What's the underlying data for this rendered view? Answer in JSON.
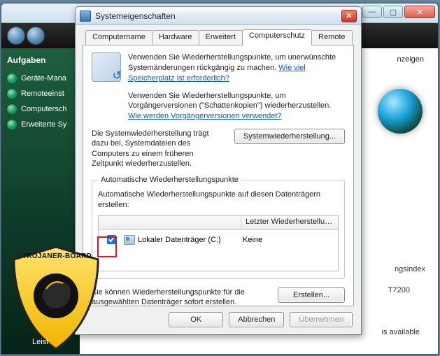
{
  "bg": {
    "tasks_header": "Aufgaben",
    "sidebar": [
      "Geräte-Mana",
      "Remoteeinst",
      "Computersch",
      "Erweiterte Sy"
    ],
    "anzeigen": "nzeigen",
    "ingsindex": "ngsindex",
    "cputext": "T7200",
    "available": "is available",
    "leist": "Leist"
  },
  "dialog": {
    "title": "Systemeigenschaften",
    "tabs": [
      "Computername",
      "Hardware",
      "Erweitert",
      "Computerschutz",
      "Remote"
    ],
    "active_tab": 3,
    "info1_pre": "Verwenden Sie Wiederherstellungspunkte, um unerwünschte Systemänderungen rückgängig zu machen. ",
    "info1_link": "Wie viel Speicherplatz ist erforderlich?",
    "info2_pre": "Verwenden Sie Wiederherstellungspunkte, um Vorgängerversionen (\"Schattenkopien\") wiederherzustellen. ",
    "info2_link": "Wie werden Vorgängerversionen verwendet?",
    "restore_desc": "Die Systemwiederherstellung trägt dazu bei, Systemdateien des Computers zu einem früheren Zeitpunkt wiederherzustellen.",
    "restore_btn": "Systemwiederherstellung...",
    "group_legend": "Automatische Wiederherstellungspunkte",
    "group_desc": "Automatische Wiederherstellungspunkte auf diesen Datenträgern erstellen:",
    "table": {
      "columns": [
        "",
        "",
        "Letzter Wiederherstellun..."
      ],
      "rows": [
        {
          "checked": true,
          "name": "Lokaler Datenträger (C:)",
          "last": "Keine"
        }
      ]
    },
    "create_desc": "Sie können Wiederherstellungspunkte für die ausgewählten Datenträger sofort erstellen.",
    "create_btn": "Erstellen...",
    "ok": "OK",
    "cancel": "Abbrechen",
    "apply": "Übernehmen"
  },
  "badge": {
    "label": "TROJANER-BOARD"
  }
}
